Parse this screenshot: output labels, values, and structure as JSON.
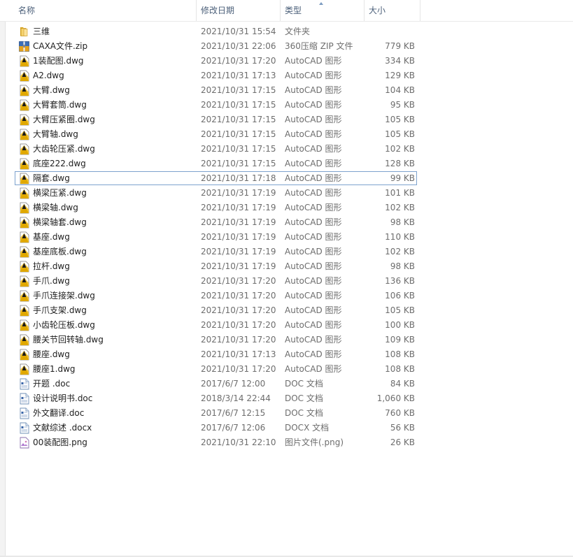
{
  "header": {
    "name": "名称",
    "date": "修改日期",
    "type": "类型",
    "size": "大小"
  },
  "selected_index": 10,
  "files": [
    {
      "name": "三维",
      "date": "2021/10/31 15:54",
      "type": "文件夹",
      "size": "",
      "icon": "folder"
    },
    {
      "name": "CAXA文件.zip",
      "date": "2021/10/31 22:06",
      "type": "360压缩 ZIP 文件",
      "size": "779 KB",
      "icon": "zip"
    },
    {
      "name": "1装配图.dwg",
      "date": "2021/10/31 17:20",
      "type": "AutoCAD 图形",
      "size": "334 KB",
      "icon": "dwg"
    },
    {
      "name": "A2.dwg",
      "date": "2021/10/31 17:13",
      "type": "AutoCAD 图形",
      "size": "129 KB",
      "icon": "dwg"
    },
    {
      "name": "大臂.dwg",
      "date": "2021/10/31 17:15",
      "type": "AutoCAD 图形",
      "size": "104 KB",
      "icon": "dwg"
    },
    {
      "name": "大臂套筒.dwg",
      "date": "2021/10/31 17:15",
      "type": "AutoCAD 图形",
      "size": "95 KB",
      "icon": "dwg"
    },
    {
      "name": "大臂压紧圈.dwg",
      "date": "2021/10/31 17:15",
      "type": "AutoCAD 图形",
      "size": "105 KB",
      "icon": "dwg"
    },
    {
      "name": "大臂轴.dwg",
      "date": "2021/10/31 17:15",
      "type": "AutoCAD 图形",
      "size": "105 KB",
      "icon": "dwg"
    },
    {
      "name": "大齿轮压紧.dwg",
      "date": "2021/10/31 17:15",
      "type": "AutoCAD 图形",
      "size": "102 KB",
      "icon": "dwg"
    },
    {
      "name": "底座222.dwg",
      "date": "2021/10/31 17:15",
      "type": "AutoCAD 图形",
      "size": "128 KB",
      "icon": "dwg"
    },
    {
      "name": "隔套.dwg",
      "date": "2021/10/31 17:18",
      "type": "AutoCAD 图形",
      "size": "99 KB",
      "icon": "dwg"
    },
    {
      "name": "横梁压紧.dwg",
      "date": "2021/10/31 17:19",
      "type": "AutoCAD 图形",
      "size": "101 KB",
      "icon": "dwg"
    },
    {
      "name": "横梁轴.dwg",
      "date": "2021/10/31 17:19",
      "type": "AutoCAD 图形",
      "size": "102 KB",
      "icon": "dwg"
    },
    {
      "name": "横梁轴套.dwg",
      "date": "2021/10/31 17:19",
      "type": "AutoCAD 图形",
      "size": "98 KB",
      "icon": "dwg"
    },
    {
      "name": "基座.dwg",
      "date": "2021/10/31 17:19",
      "type": "AutoCAD 图形",
      "size": "110 KB",
      "icon": "dwg"
    },
    {
      "name": "基座底板.dwg",
      "date": "2021/10/31 17:19",
      "type": "AutoCAD 图形",
      "size": "102 KB",
      "icon": "dwg"
    },
    {
      "name": "拉杆.dwg",
      "date": "2021/10/31 17:19",
      "type": "AutoCAD 图形",
      "size": "98 KB",
      "icon": "dwg"
    },
    {
      "name": "手爪.dwg",
      "date": "2021/10/31 17:20",
      "type": "AutoCAD 图形",
      "size": "136 KB",
      "icon": "dwg"
    },
    {
      "name": "手爪连接架.dwg",
      "date": "2021/10/31 17:20",
      "type": "AutoCAD 图形",
      "size": "106 KB",
      "icon": "dwg"
    },
    {
      "name": "手爪支架.dwg",
      "date": "2021/10/31 17:20",
      "type": "AutoCAD 图形",
      "size": "105 KB",
      "icon": "dwg"
    },
    {
      "name": "小齿轮压板.dwg",
      "date": "2021/10/31 17:20",
      "type": "AutoCAD 图形",
      "size": "100 KB",
      "icon": "dwg"
    },
    {
      "name": "腰关节回转轴.dwg",
      "date": "2021/10/31 17:20",
      "type": "AutoCAD 图形",
      "size": "109 KB",
      "icon": "dwg"
    },
    {
      "name": "腰座.dwg",
      "date": "2021/10/31 17:13",
      "type": "AutoCAD 图形",
      "size": "108 KB",
      "icon": "dwg"
    },
    {
      "name": "腰座1.dwg",
      "date": "2021/10/31 17:20",
      "type": "AutoCAD 图形",
      "size": "108 KB",
      "icon": "dwg"
    },
    {
      "name": "开题 .doc",
      "date": "2017/6/7 12:00",
      "type": "DOC 文档",
      "size": "84 KB",
      "icon": "doc"
    },
    {
      "name": "设计说明书.doc",
      "date": "2018/3/14 22:44",
      "type": "DOC 文档",
      "size": "1,060 KB",
      "icon": "doc"
    },
    {
      "name": "外文翻译.doc",
      "date": "2017/6/7 12:15",
      "type": "DOC 文档",
      "size": "760 KB",
      "icon": "doc"
    },
    {
      "name": "文献综述 .docx",
      "date": "2017/6/7 12:06",
      "type": "DOCX 文档",
      "size": "56 KB",
      "icon": "doc"
    },
    {
      "name": "00装配图.png",
      "date": "2021/10/31 22:10",
      "type": "图片文件(.png)",
      "size": "26 KB",
      "icon": "png"
    }
  ]
}
